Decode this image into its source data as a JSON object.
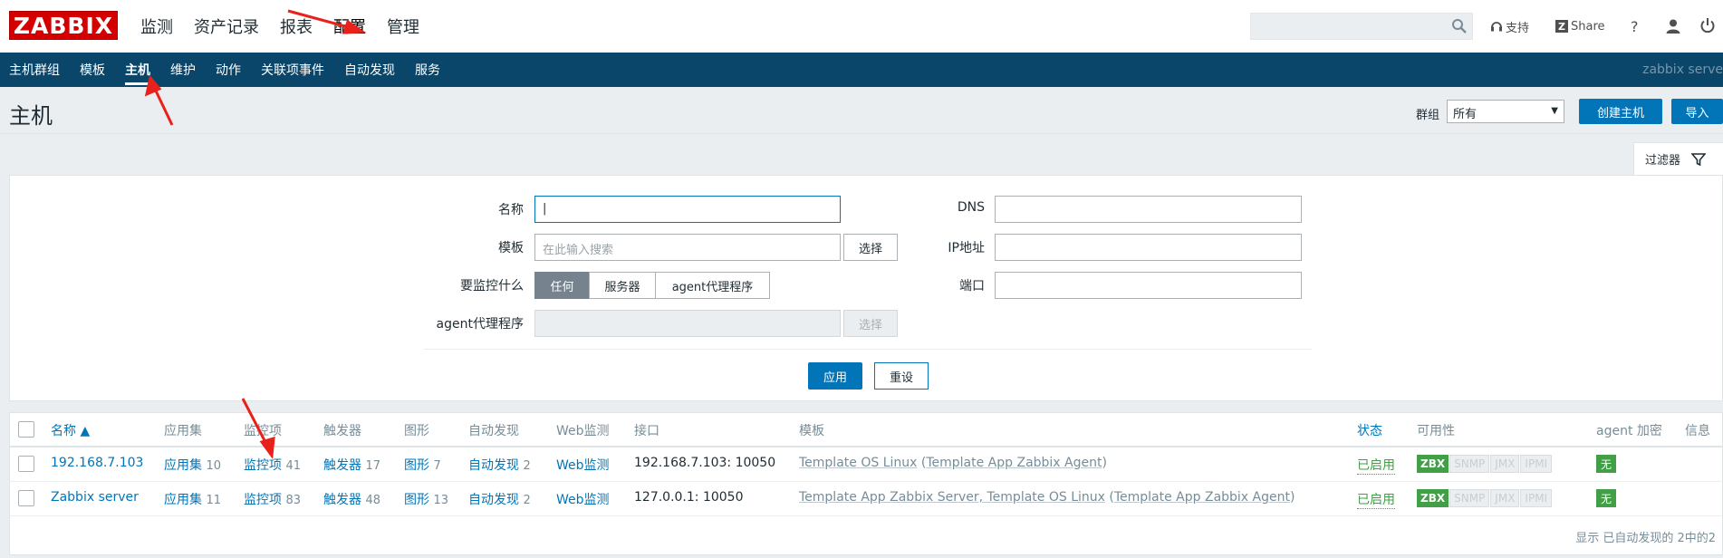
{
  "logo": "ZABBIX",
  "main_menu": [
    "监测",
    "资产记录",
    "报表",
    "配置",
    "管理"
  ],
  "main_menu_active": "配置",
  "top_right": {
    "support": "支持",
    "share": "Share",
    "help": "?",
    "share_icon_letter": "Z"
  },
  "sub_menu": [
    "主机群组",
    "模板",
    "主机",
    "维护",
    "动作",
    "关联项事件",
    "自动发现",
    "服务"
  ],
  "sub_menu_active": "主机",
  "server_name": "zabbix serve",
  "page_title": "主机",
  "header": {
    "group_label": "群组",
    "group_value": "所有",
    "create_button": "创建主机",
    "import_button": "导入"
  },
  "filter": {
    "tab_label": "过滤器",
    "name_label": "名称",
    "name_value": "|",
    "template_label": "模板",
    "template_placeholder": "在此输入搜索",
    "select_button": "选择",
    "monitor_label": "要监控什么",
    "monitor_options": [
      "任何",
      "服务器",
      "agent代理程序"
    ],
    "proxy_label": "agent代理程序",
    "proxy_select_button": "选择",
    "dns_label": "DNS",
    "ip_label": "IP地址",
    "port_label": "端口",
    "apply_button": "应用",
    "reset_button": "重设"
  },
  "table": {
    "headers": [
      "名称 ▲",
      "应用集",
      "监控项",
      "触发器",
      "图形",
      "自动发现",
      "Web监测",
      "接口",
      "模板",
      "状态",
      "可用性",
      "agent 加密",
      "信息"
    ],
    "rows": [
      {
        "name": "192.168.7.103",
        "apps": "应用集",
        "apps_count": "10",
        "items": "监控项",
        "items_count": "41",
        "triggers": "触发器",
        "triggers_count": "17",
        "graphs": "图形",
        "graphs_count": "7",
        "discovery": "自动发现",
        "discovery_count": "2",
        "web": "Web监测",
        "interface": "192.168.7.103: 10050",
        "templates": "Template OS Linux",
        "templates_extra": "Template App Zabbix Agent",
        "status": "已启用",
        "availability": [
          "ZBX",
          "SNMP",
          "JMX",
          "IPMI"
        ],
        "encryption": "无"
      },
      {
        "name": "Zabbix server",
        "apps": "应用集",
        "apps_count": "11",
        "items": "监控项",
        "items_count": "83",
        "triggers": "触发器",
        "triggers_count": "48",
        "graphs": "图形",
        "graphs_count": "13",
        "discovery": "自动发现",
        "discovery_count": "2",
        "web": "Web监测",
        "interface": "127.0.0.1: 10050",
        "templates": "Template App Zabbix Server, Template OS Linux",
        "templates_extra": "Template App Zabbix Agent",
        "status": "已启用",
        "availability": [
          "ZBX",
          "SNMP",
          "JMX",
          "IPMI"
        ],
        "encryption": "无"
      }
    ],
    "footer": "显示 已自动发现的 2中的2"
  },
  "colors": {
    "header_bar": "#0a466a",
    "accent": "#0275b8",
    "logo": "#d40000",
    "green": "#429e47",
    "annotation_arrow": "#e8211a"
  }
}
